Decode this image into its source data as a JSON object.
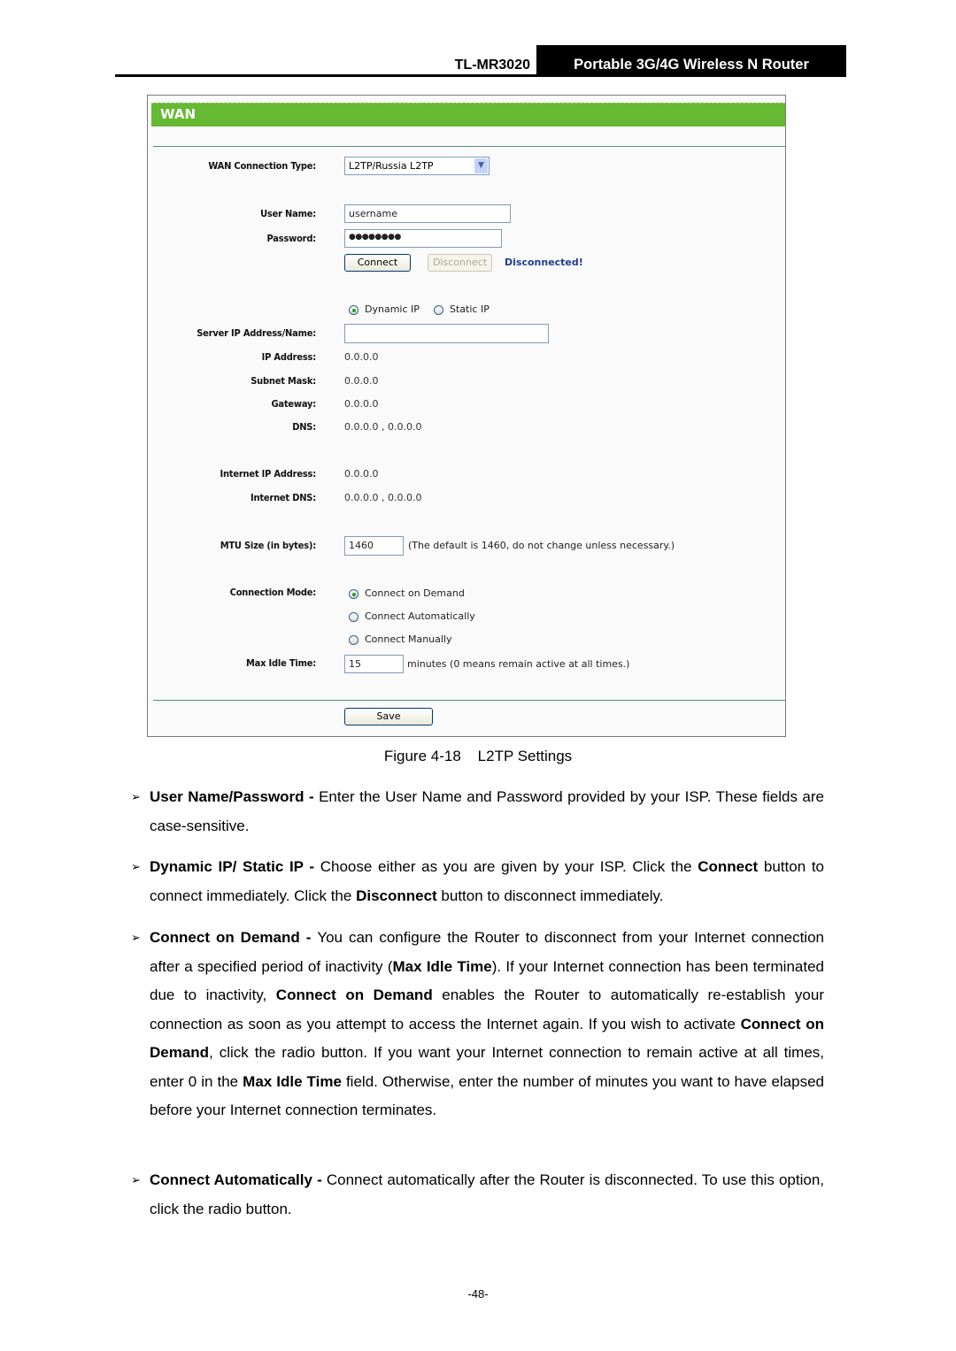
{
  "header": {
    "model": "TL-MR3020",
    "product": "Portable 3G/4G Wireless N Router"
  },
  "panel": {
    "title": "WAN",
    "wan_connection_type": {
      "label": "WAN Connection Type:",
      "value": "L2TP/Russia L2TP"
    },
    "user_name": {
      "label": "User Name:",
      "value": "username"
    },
    "password": {
      "label": "Password:",
      "value": "●●●●●●●●"
    },
    "connect_button": "Connect",
    "disconnect_button": "Disconnect",
    "status": "Disconnected!",
    "ip_mode": {
      "dynamic_label": "Dynamic IP",
      "static_label": "Static IP",
      "selected": "Dynamic IP"
    },
    "server": {
      "label": "Server IP Address/Name:",
      "value": ""
    },
    "ip_address": {
      "label": "IP Address:",
      "value": "0.0.0.0"
    },
    "subnet_mask": {
      "label": "Subnet Mask:",
      "value": "0.0.0.0"
    },
    "gateway": {
      "label": "Gateway:",
      "value": "0.0.0.0"
    },
    "dns": {
      "label": "DNS:",
      "value": "0.0.0.0 , 0.0.0.0"
    },
    "internet_ip": {
      "label": "Internet IP Address:",
      "value": "0.0.0.0"
    },
    "internet_dns": {
      "label": "Internet DNS:",
      "value": "0.0.0.0 , 0.0.0.0"
    },
    "mtu": {
      "label": "MTU Size (in bytes):",
      "value": "1460",
      "hint": "(The default is 1460, do not change unless necessary.)"
    },
    "connection_mode": {
      "label": "Connection Mode:",
      "options": [
        "Connect on Demand",
        "Connect Automatically",
        "Connect Manually"
      ],
      "selected": "Connect on Demand"
    },
    "max_idle": {
      "label": "Max Idle Time:",
      "value": "15",
      "hint": "minutes (0 means remain active at all times.)"
    },
    "save_button": "Save"
  },
  "caption": "Figure 4-18    L2TP Settings",
  "bullets": [
    {
      "parts": [
        {
          "b": "User Name/Password - "
        },
        {
          "t": "Enter the User Name and Password provided by your ISP. These fields are case-sensitive."
        }
      ]
    },
    {
      "parts": [
        {
          "b": "Dynamic IP/ Static IP - "
        },
        {
          "t": "Choose either as you are given by your ISP. Click the "
        },
        {
          "b": "Connect"
        },
        {
          "t": " button to connect immediately. Click the "
        },
        {
          "b": "Disconnect"
        },
        {
          "t": " button to disconnect immediately."
        }
      ]
    },
    {
      "parts": [
        {
          "b": "Connect on Demand - "
        },
        {
          "t": "You can configure the Router to disconnect from your Internet connection after a specified period of inactivity ("
        },
        {
          "b": "Max Idle Time"
        },
        {
          "t": "). If your Internet connection has been terminated due to inactivity, "
        },
        {
          "b": "Connect on Demand"
        },
        {
          "t": " enables the Router to automatically re-establish your connection as soon as you attempt to access the Internet again. If you wish to activate "
        },
        {
          "b": "Connect on Demand"
        },
        {
          "t": ", click the radio button. If you want your Internet connection to remain active at all times, enter 0 in the "
        },
        {
          "b": "Max Idle Time"
        },
        {
          "t": " field. Otherwise, enter the number of minutes you want to have elapsed before your Internet connection terminates."
        }
      ]
    },
    {
      "parts": [
        {
          "b": "Connect Automatically - "
        },
        {
          "t": "Connect automatically after the Router is disconnected. To use this option, click the radio button."
        }
      ]
    }
  ],
  "bullet_glyph": "➢",
  "page_number": "-48-"
}
